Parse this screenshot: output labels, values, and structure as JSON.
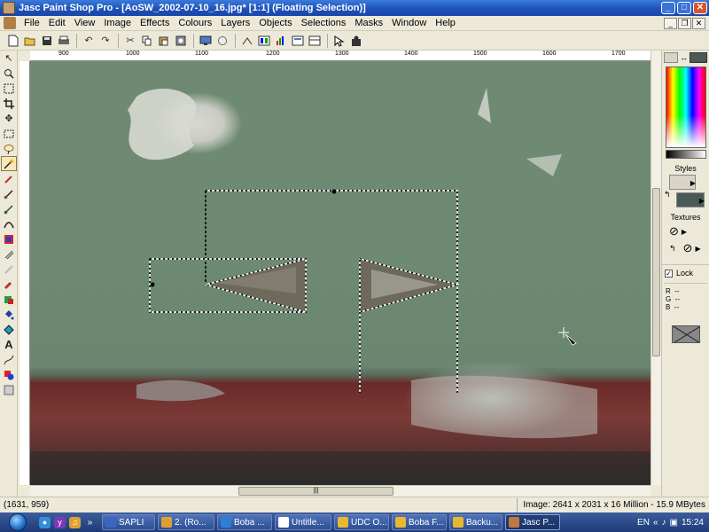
{
  "window": {
    "title": "Jasc Paint Shop Pro - [AoSW_2002-07-10_16.jpg* [1:1] (Floating Selection)]",
    "min_label": "_",
    "max_label": "□",
    "close_label": "✕"
  },
  "menu": {
    "items": [
      "File",
      "Edit",
      "View",
      "Image",
      "Effects",
      "Colours",
      "Layers",
      "Objects",
      "Selections",
      "Masks",
      "Window",
      "Help"
    ],
    "mdi_min": "_",
    "mdi_restore": "❐",
    "mdi_close": "✕"
  },
  "toolbar": {
    "icons": [
      "new-icon",
      "open-icon",
      "save-icon",
      "print-icon",
      "undo-icon",
      "redo-icon",
      "cut-icon",
      "copy-icon",
      "paste-icon",
      "browse-icon",
      "full-screen-icon",
      "zoom-icon",
      "toggle-toolbar-icon",
      "color-palette-icon",
      "histogram-icon",
      "overview-icon",
      "help-icon",
      "context-help-icon"
    ]
  },
  "ruler": {
    "labels": [
      "900",
      "1000",
      "1100",
      "1200",
      "1300",
      "1400",
      "1500",
      "1600",
      "1700"
    ]
  },
  "panel": {
    "styles_label": "Styles",
    "textures_label": "Textures",
    "lock_label": "Lock",
    "lock_checked": "✓",
    "r_label": "R",
    "g_label": "G",
    "b_label": "B",
    "r_value": "--",
    "g_value": "--",
    "b_value": "--",
    "fg_color": "#d8d4c8",
    "bg_color": "#4a5a56"
  },
  "status": {
    "coords": "(1631, 959)",
    "image_info": "Image:  2641 x 2031 x 16 Million - 15.9 MBytes"
  },
  "scrollbar": {
    "grip": "|||"
  },
  "taskbar": {
    "tasks": [
      {
        "label": "SAPLI",
        "color": "#3a66c0"
      },
      {
        "label": "2. (Ro...",
        "color": "#e0a030"
      },
      {
        "label": "Boba ...",
        "color": "#2f7fd8"
      },
      {
        "label": "Untitle...",
        "color": "#ffffff"
      },
      {
        "label": "UDC O...",
        "color": "#e8b830"
      },
      {
        "label": "Boba F...",
        "color": "#e8b830"
      },
      {
        "label": "Backu...",
        "color": "#e8b830"
      },
      {
        "label": "Jasc P...",
        "color": "#c07840"
      }
    ],
    "language": "EN",
    "clock": "15:24"
  }
}
